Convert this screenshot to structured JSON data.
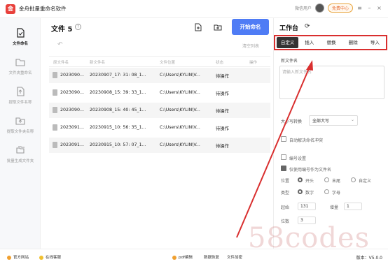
{
  "app": {
    "title": "金舟批量重命名软件",
    "user": "微信用户",
    "vip": "免费中心"
  },
  "sidebar": {
    "items": [
      {
        "label": "文件命名",
        "active": true
      },
      {
        "label": "文件夹重命名",
        "active": false
      },
      {
        "label": "提取文件名称",
        "active": false
      },
      {
        "label": "提取文件夹名称",
        "active": false
      },
      {
        "label": "批量生成文件夹",
        "active": false
      }
    ]
  },
  "main": {
    "title": "文件 5",
    "start_label": "开始命名",
    "clear_label": "清空列表",
    "columns": [
      "原文件名",
      "新文件名",
      "文件位置",
      "状态",
      "操作"
    ],
    "rows": [
      [
        "2023090...",
        "20230907_17: 31: 08_1...",
        "C:\\Users\\KYLIN\\V...",
        "待操作"
      ],
      [
        "2023090...",
        "20230908_15: 39: 33_1...",
        "C:\\Users\\KYLIN\\V...",
        "待操作"
      ],
      [
        "2023090...",
        "20230908_15: 40: 45_1...",
        "C:\\Users\\KYLIN\\V...",
        "待操作"
      ],
      [
        "2023091...",
        "20230915_10: 56: 35_1...",
        "C:\\Users\\KYLIN\\V...",
        "待操作"
      ],
      [
        "2023091...",
        "20230915_10: 57: 07_1...",
        "C:\\Users\\KYLIN\\V...",
        "待操作"
      ]
    ]
  },
  "panel": {
    "title": "工作台",
    "tabs": [
      "自定义",
      "插入",
      "替换",
      "删除",
      "导入"
    ],
    "new_name_label": "新文件名",
    "new_name_placeholder": "请输入新文件名",
    "case_label": "大小写转换",
    "case_value": "全部大写",
    "conflict_label": "自动解决命名冲突",
    "numbering_label": "编号设置",
    "only_number_label": "仅使用编号作为文件名",
    "position_label": "位置",
    "positions": [
      "开头",
      "末尾",
      "自定义"
    ],
    "type_label": "类型",
    "types": [
      "数字",
      "字母"
    ],
    "start_label": "起始",
    "start_value": "131",
    "increment_label": "增量",
    "increment_value": "1",
    "digits_label": "位数",
    "digits_value": "3"
  },
  "footer": {
    "website": "官方网站",
    "service": "在线客服",
    "links": [
      "pdf编辑",
      "数据恢复",
      "文件加密"
    ],
    "version": "版本：V5.0.0"
  },
  "watermark": "58codes",
  "colors": {
    "accent": "#4f7cf5",
    "highlight": "#d92f2f"
  }
}
